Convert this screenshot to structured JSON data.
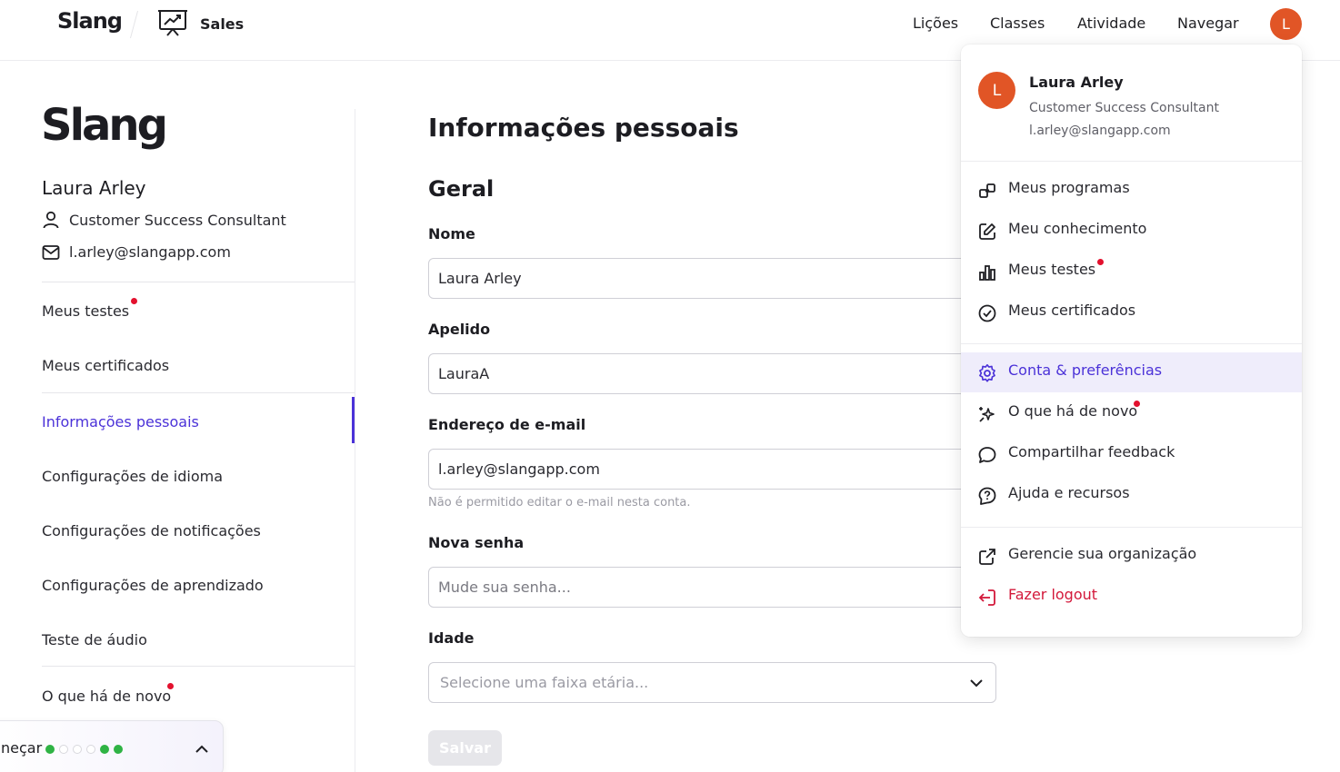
{
  "topbar": {
    "logo": "Slang",
    "app_name": "Sales",
    "nav": [
      "Lições",
      "Classes",
      "Atividade",
      "Navegar"
    ],
    "avatar_initial": "L"
  },
  "sidebar": {
    "logo": "Slang",
    "user_name": "Laura Arley",
    "user_role": "Customer Success Consultant",
    "user_email": "l.arley@slangapp.com",
    "items": [
      {
        "label": "Meus testes"
      },
      {
        "label": "Meus certificados"
      },
      {
        "label": "Informações pessoais"
      },
      {
        "label": "Configurações de idioma"
      },
      {
        "label": "Configurações de notificações"
      },
      {
        "label": "Configurações de aprendizado"
      },
      {
        "label": "Teste de áudio"
      },
      {
        "label": "O que há de novo"
      }
    ]
  },
  "onboarding": {
    "label": "neçar",
    "steps": [
      "done",
      "todo",
      "todo",
      "todo",
      "done",
      "done"
    ]
  },
  "main": {
    "title": "Informações pessoais",
    "section": "Geral",
    "name_label": "Nome",
    "name_value": "Laura Arley",
    "nickname_label": "Apelido",
    "nickname_value": "LauraA",
    "email_label": "Endereço de e-mail",
    "email_value": "l.arley@slangapp.com",
    "email_helper": "Não é permitido editar o e-mail nesta conta.",
    "password_label": "Nova senha",
    "password_placeholder": "Mude sua senha...",
    "age_label": "Idade",
    "age_placeholder": "Selecione uma faixa etária...",
    "save_label": "Salvar"
  },
  "menu": {
    "avatar_initial": "L",
    "name": "Laura Arley",
    "role": "Customer Success Consultant",
    "email": "l.arley@slangapp.com",
    "items": [
      {
        "label": "Meus programas",
        "icon": "programs-icon"
      },
      {
        "label": "Meu conhecimento",
        "icon": "edit-icon"
      },
      {
        "label": "Meus testes",
        "icon": "bar-chart-icon"
      },
      {
        "label": "Meus certificados",
        "icon": "badge-check-icon"
      },
      {
        "label": "Conta & preferências",
        "icon": "gear-icon"
      },
      {
        "label": "O que há de novo",
        "icon": "sparkles-icon"
      },
      {
        "label": "Compartilhar feedback",
        "icon": "chat-bubble-icon"
      },
      {
        "label": "Ajuda e recursos",
        "icon": "help-icon"
      },
      {
        "label": "Gerencie sua organização",
        "icon": "external-link-icon"
      },
      {
        "label": "Fazer logout",
        "icon": "logout-icon"
      }
    ]
  },
  "colors": {
    "accent": "#4b32d8",
    "avatar": "#e15526",
    "notification_dot": "#e3112e",
    "danger": "#d3183a",
    "progress_done": "#2fb344"
  }
}
